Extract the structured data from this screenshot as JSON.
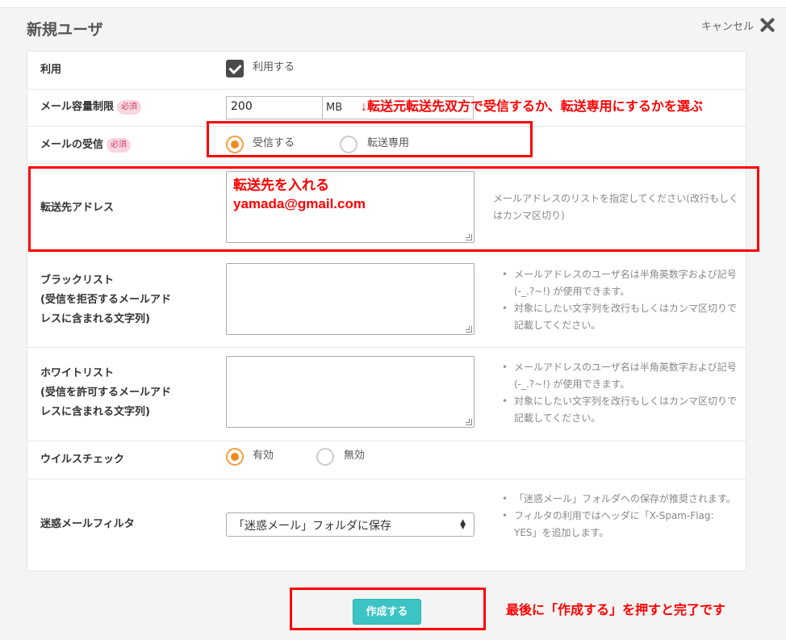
{
  "header": {
    "title": "新規ユーザ",
    "cancel_label": "キャンセル"
  },
  "form": {
    "use": {
      "label": "利用",
      "checkbox_label": "利用する",
      "checked": true
    },
    "mail_quota": {
      "label": "メール容量制限",
      "required": "必須",
      "value": "200",
      "unit": "MB"
    },
    "receive": {
      "label": "メールの受信",
      "required": "必須",
      "options": [
        "受信する",
        "転送専用"
      ],
      "selected": "受信する"
    },
    "forward": {
      "label": "転送先アドレス",
      "value_line1": "転送先を入れる",
      "value_line2": "yamada@gmail.com",
      "help": "メールアドレスのリストを指定してください(改行もしくはカンマ区切り)"
    },
    "blacklist": {
      "label_line1": "ブラックリスト",
      "label_line2": "(受信を拒否するメールアド",
      "label_line3": "レスに含まれる文字列)",
      "help": [
        "メールアドレスのユーザ名は半角英数字および記号(-_.?~!) が使用できます。",
        "対象にしたい文字列を改行もしくはカンマ区切りで記載してください。"
      ]
    },
    "whitelist": {
      "label_line1": "ホワイトリスト",
      "label_line2": "(受信を許可するメールアド",
      "label_line3": "レスに含まれる文字列)",
      "help": [
        "メールアドレスのユーザ名は半角英数字および記号(-_.?~!) が使用できます。",
        "対象にしたい文字列を改行もしくはカンマ区切りで記載してください。"
      ]
    },
    "virus": {
      "label": "ウイルスチェック",
      "options": [
        "有効",
        "無効"
      ],
      "selected": "有効"
    },
    "spam": {
      "label": "迷惑メールフィルタ",
      "selected": "「迷惑メール」フォルダに保存",
      "help": [
        "「迷惑メール」フォルダへの保存が推奨されます。",
        "フィルタの利用ではヘッダに「X-Spam-Flag: YES」を追加します。"
      ]
    }
  },
  "actions": {
    "create_label": "作成する"
  },
  "annotations": {
    "receive_note": "↓転送元転送先双方で受信するか、転送専用にするかを選ぶ",
    "final_note": "最後に「作成する」を押すと完了です"
  },
  "colors": {
    "accent": "#3cc4c4",
    "radio": "#f08c1e",
    "annotation": "#ff0000",
    "required_bg": "#f9d6e0"
  }
}
